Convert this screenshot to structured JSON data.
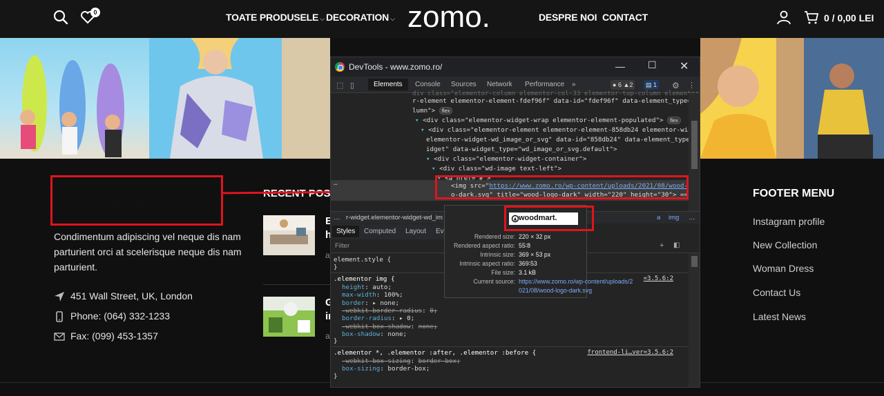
{
  "header": {
    "wishlist_count": "0",
    "nav_left": [
      "TOATE PRODUSELE",
      "DECORATION"
    ],
    "logo": "zomo.",
    "nav_right": [
      "DESPRE NOI",
      "CONTACT"
    ],
    "cart_total": "0 / 0,00 LEI",
    "icons": [
      "search-icon",
      "heart-icon",
      "chevron-down-icon",
      "user-icon",
      "cart-icon"
    ]
  },
  "footer": {
    "logo_text": "woodmart.",
    "description": "Condimentum adipiscing vel neque dis nam parturient orci at scelerisque neque dis nam parturient.",
    "address": "451 Wall Street, UK, London",
    "phone": "Phone: (064) 332-1233",
    "fax": "Fax: (099) 453-1357",
    "recent_posts_title": "RECENT POS",
    "recent_post_letters": [
      "E",
      "h",
      "a",
      "G",
      "in",
      "a"
    ],
    "menu_title": "FOOTER MENU",
    "menu_links": [
      "Instagram profile",
      "New Collection",
      "Woman Dress",
      "Contact Us",
      "Latest News"
    ]
  },
  "devtools": {
    "title": "DevTools - www.zomo.ro/",
    "tabs": [
      "Elements",
      "Console",
      "Sources",
      "Network",
      "Performance",
      "»"
    ],
    "issues": [
      "6",
      "2",
      "1"
    ],
    "code_lines": [
      "r-element elementor-element-fdef96f\" data-id=\"fdef96f\" data-element_type=\"co",
      "lumn\">",
      "<div class=\"elementor-widget-wrap elementor-element-populated\">",
      "<div class=\"elementor-element elementor-element-858db24 elementor-widget",
      "elementor-widget-wd_image_or_svg\" data-id=\"858db24\" data-element_type=\"w",
      "idget\" data-widget_type=\"wd_image_or_svg.default\">",
      "<div class=\"elementor-widget-container\">",
      "<div class=\"wd-image text-left\">",
      "<a href=\"#\">"
    ],
    "flex_badge": "flex",
    "img_src_url": "https://www.zomo.ro/wp-content/uploads/2021/08/wood-logo-dark.svg",
    "img_line_1_pre": "<img src=\"",
    "img_line_1_link": "https://www.zomo.ro/wp-content/uploads/2021/08/wood-lo",
    "img_line_2": "o-dark.svg\" title=\"wood-logo-dark\" width=\"220\" height=\"30\"> == $0",
    "breadcrumb": "r-widget.elementor-widget-wd_im",
    "breadcrumb_right": [
      "a",
      "img"
    ],
    "styles_tabs": [
      "Styles",
      "Computed",
      "Layout",
      "Eve"
    ],
    "filter_placeholder": "Filter",
    "css_rules": {
      "element_style": "element.style {",
      "rule1_selector": ".elementor img {",
      "rule1_source": "=3.5.6:2",
      "rule1_props": [
        {
          "p": "height",
          "v": "auto;",
          "strike": false
        },
        {
          "p": "max-width",
          "v": "100%;",
          "strike": false
        },
        {
          "p": "border",
          "v": "▸ none;",
          "strike": false
        },
        {
          "p": "-webkit-border-radius",
          "v": "0;",
          "strike": true
        },
        {
          "p": "border-radius",
          "v": "▸ 0;",
          "strike": false
        },
        {
          "p": "-webkit-box-shadow",
          "v": "none;",
          "strike": true
        },
        {
          "p": "box-shadow",
          "v": "none;",
          "strike": false
        }
      ],
      "rule2_selector": ".elementor *, .elementor :after, .elementor :before {",
      "rule2_source": "frontend-li…ver=3.5.6:2",
      "rule2_props": [
        {
          "p": "-webkit-box-sizing",
          "v": "border-box;",
          "strike": true
        },
        {
          "p": "box-sizing",
          "v": "border-box;",
          "strike": false
        }
      ],
      "close": "}"
    },
    "tooltip": {
      "preview_text": "woodmart.",
      "rows": [
        {
          "k": "Rendered size:",
          "v": "220 × 32 px"
        },
        {
          "k": "Rendered aspect ratio:",
          "v": "55∶8"
        },
        {
          "k": "Intrinsic size:",
          "v": "369 × 53 px"
        },
        {
          "k": "Intrinsic aspect ratio:",
          "v": "369∶53"
        },
        {
          "k": "File size:",
          "v": "3.1 kB"
        },
        {
          "k": "Current source:",
          "v": "https://www.zomo.ro/wp-content/uploads/2"
        },
        {
          "k": "",
          "v": "021/08/wood-logo-dark.svg"
        }
      ]
    }
  },
  "colors": {
    "header_bg": "#151515",
    "footer_bg": "#101010",
    "annotation_red": "#e0141e",
    "devtools_bg": "#242424",
    "link_blue": "#7cacf8"
  }
}
